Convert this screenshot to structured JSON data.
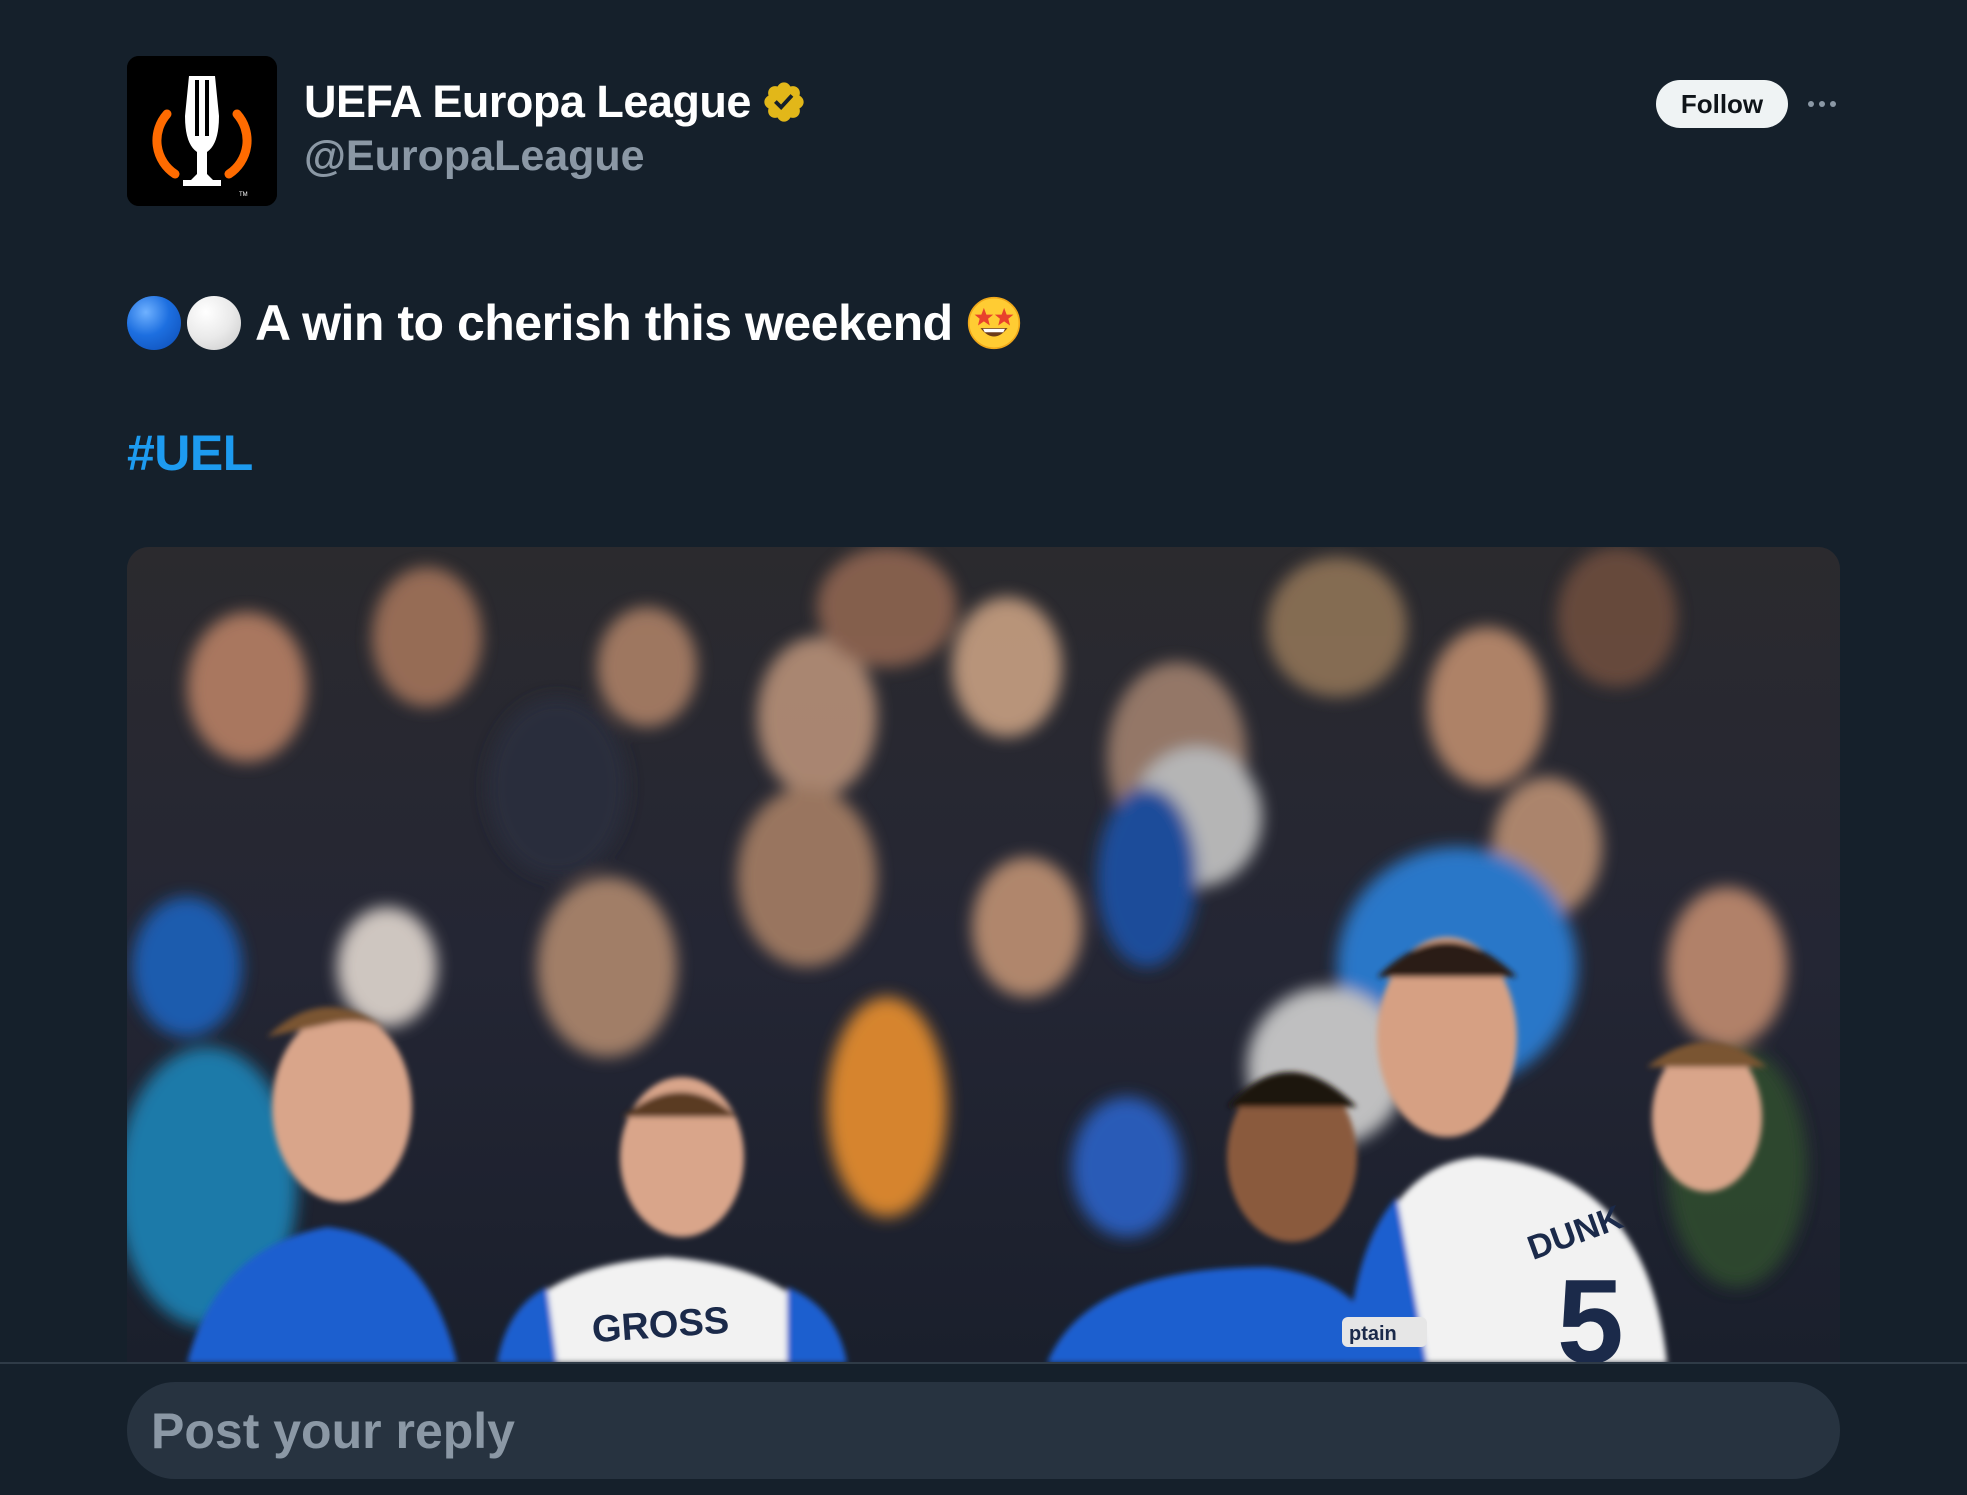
{
  "author": {
    "display_name": "UEFA Europa League",
    "handle": "@EuropaLeague",
    "verified_badge": "gold-verified-check",
    "avatar_icon": "europa-league-trophy-logo"
  },
  "header": {
    "follow_label": "Follow",
    "more_icon": "more-options-icon"
  },
  "tweet": {
    "leading_emojis": [
      "blue-circle",
      "white-circle"
    ],
    "text": "A win to cherish this weekend",
    "trailing_emoji": "star-struck",
    "hashtag": "#UEL"
  },
  "media": {
    "description_icon": "photo",
    "shirt_names": [
      "GROSS",
      "DUNK"
    ],
    "shirt_number": "5",
    "armband_text": "ptain"
  },
  "reply": {
    "placeholder": "Post your reply"
  },
  "colors": {
    "background": "#15202b",
    "text": "#ffffff",
    "secondary_text": "#8b98a5",
    "link": "#1d9bf0",
    "verified_gold": "#e2b719",
    "logo_orange": "#ff6b00"
  }
}
